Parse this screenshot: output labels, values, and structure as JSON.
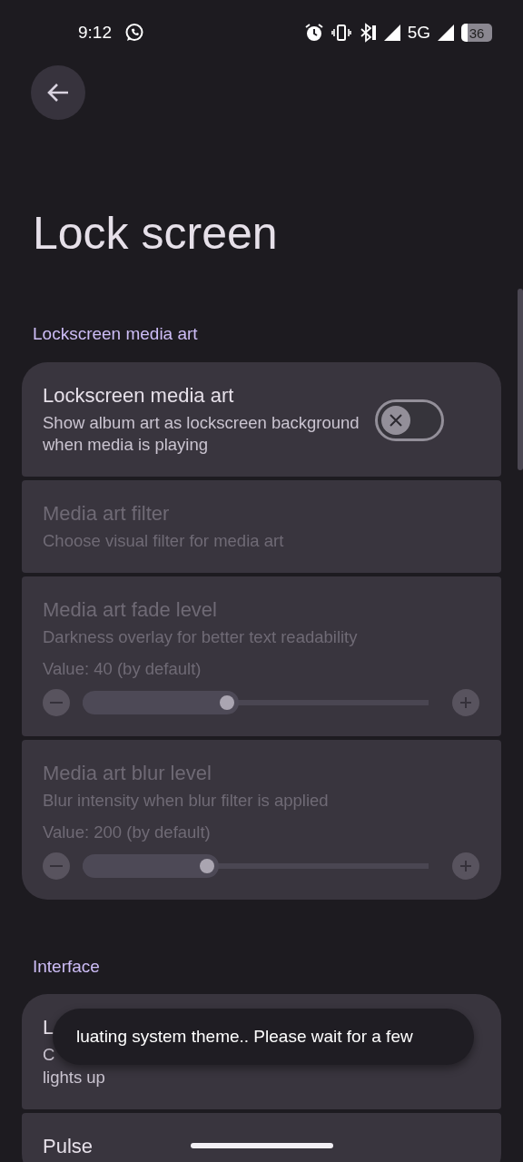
{
  "status_bar": {
    "time": "9:12",
    "network": "5G",
    "battery": "36"
  },
  "title": "Lock screen",
  "sections": [
    {
      "heading": "Lockscreen media art",
      "items": [
        {
          "kind": "switch",
          "title": "Lockscreen media art",
          "subtitle": "Show album art as lockscreen background when media is playing",
          "disabled": false,
          "on": false
        },
        {
          "kind": "option",
          "title": "Media art filter",
          "subtitle": "Choose visual filter for media art",
          "disabled": true
        },
        {
          "kind": "slider",
          "title": "Media art fade level",
          "subtitle": "Darkness overlay for better text readability",
          "value_text": "Value: 40 (by default)",
          "level": 0.41,
          "disabled": true
        },
        {
          "kind": "slider",
          "title": "Media art blur level",
          "subtitle": "Blur intensity when blur filter is applied",
          "value_text": "Value: 200 (by default)",
          "level": 0.35,
          "disabled": true
        }
      ]
    },
    {
      "heading": "Interface",
      "items": [
        {
          "kind": "option",
          "title": "L",
          "subtitle_lines": [
            "C",
            "lights up"
          ],
          "disabled": false
        },
        {
          "kind": "option",
          "title": "Pulse",
          "disabled": false
        }
      ]
    }
  ],
  "toast": "luating system theme.. Please wait for a few"
}
